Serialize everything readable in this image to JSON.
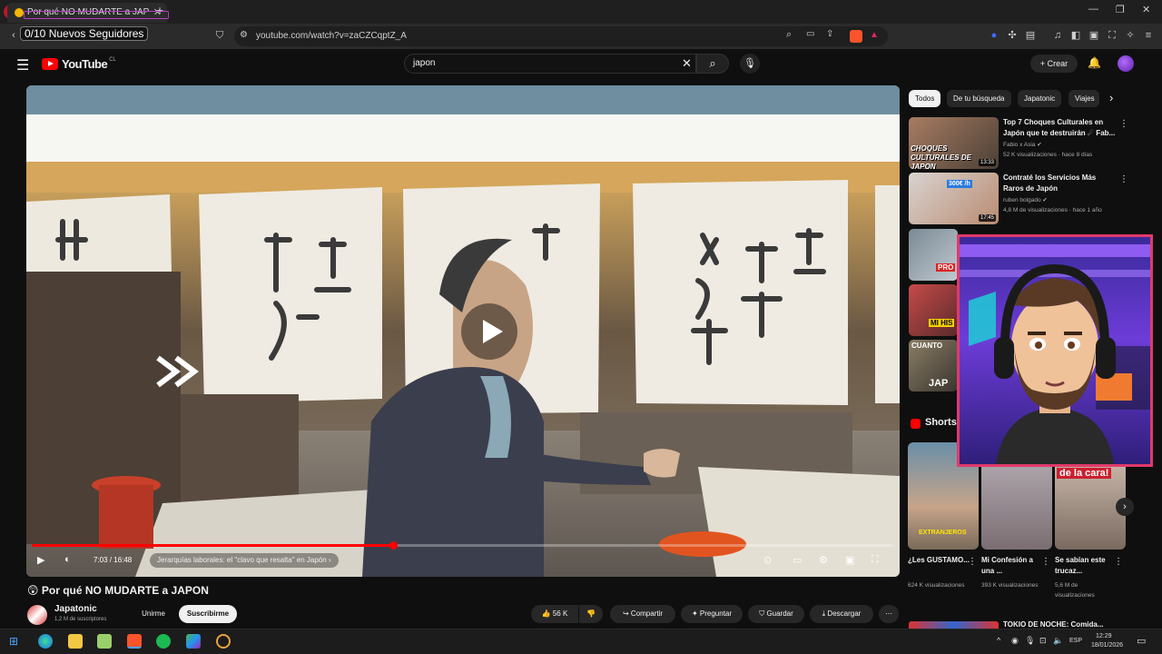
{
  "browser": {
    "tab_title": "Por qué NO MUDARTE a JAP",
    "url": "youtube.com/watch?v=zaCZCqptZ_A"
  },
  "stream_overlay": {
    "followers_goal": "0/10 Nuevos Seguidores"
  },
  "youtube": {
    "logo_text": "YouTube",
    "logo_country": "CL",
    "search_value": "japon",
    "create_label": "Crear"
  },
  "video": {
    "time": "7:03 / 16:48",
    "progress": 0.42,
    "chapter": "Jerarquías laborales: el \"clavo que resalta\" en Japón",
    "title": "Por qué NO MUDARTE a JAPON",
    "title_emoji": "😲",
    "channel_name": "Japatonic",
    "channel_subs": "1,2 M de suscriptores",
    "join_label": "Unirme",
    "subscribe_label": "Suscribirme",
    "likes": "56 K",
    "share_label": "Compartir",
    "ask_label": "Preguntar",
    "save_label": "Guardar",
    "download_label": "Descargar"
  },
  "sidebar": {
    "chips": [
      "Todos",
      "De tu búsqueda",
      "Japatonic",
      "Viajes"
    ],
    "recommendations": [
      {
        "title": "Top 7 Choques Culturales en Japón que te destruirán ☄ Fab...",
        "channel": "Fabio x Asia",
        "meta": "52 K visualizaciones · hace 8 días",
        "duration": "13:33",
        "thumb_text": "CHOQUES CULTURALES DE JAPON"
      },
      {
        "title": "Contraté los Servicios Más Raros de Japón",
        "channel": "ruben bolgado",
        "meta": "4,8 M de visualizaciones · hace 1 año",
        "duration": "17:45",
        "thumb_text": "300€ /h"
      }
    ],
    "partial_thumb_texts": [
      "PRO",
      "MI HIS",
      "CUANTO",
      "JAP"
    ],
    "shorts_label": "Shorts",
    "shorts": [
      {
        "title": "¿Les GUSTAMO...",
        "views": "624 K visualizaciones",
        "thumb_text": "EXTRANJEROS"
      },
      {
        "title": "Mi Confesión a una ...",
        "views": "393 K visualizaciones",
        "thumb_text": ""
      },
      {
        "title": "Se sabían este trucaz...",
        "views": "5,6 M de visualizaciones",
        "thumb_text": "de la cara!"
      }
    ],
    "next_item_partial": "TOKIO DE NOCHE: Comida..."
  },
  "taskbar": {
    "lang": "ESP",
    "time": "12:29",
    "date": "18/01/2026"
  },
  "colors": {
    "accent": "#ff0000",
    "background": "#0f0f0f",
    "webcam_border": "#e03a6a"
  }
}
